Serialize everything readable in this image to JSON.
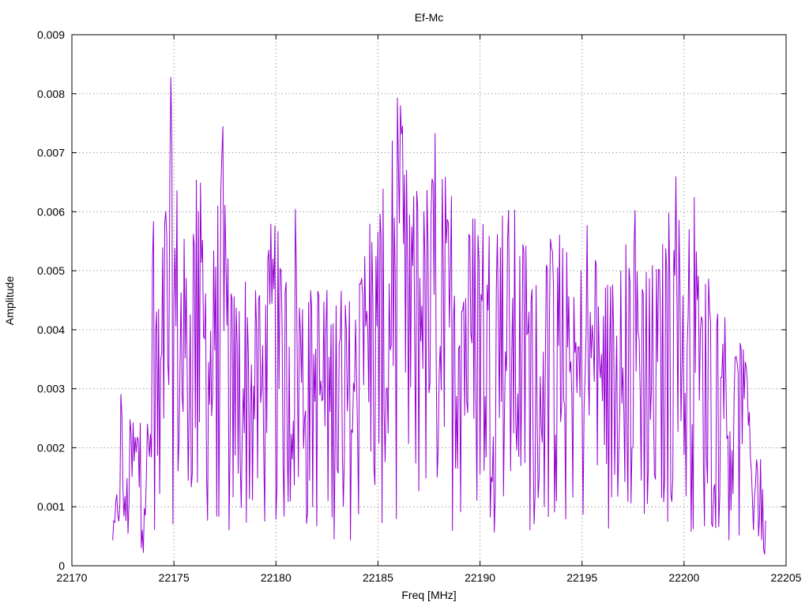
{
  "chart_data": {
    "type": "line",
    "title": "Ef-Mc",
    "xlabel": "Freq [MHz]",
    "ylabel": "Amplitude",
    "xlim": [
      22170,
      22205
    ],
    "ylim": [
      0,
      0.009
    ],
    "x_ticks": [
      "22170",
      "22175",
      "22180",
      "22185",
      "22190",
      "22195",
      "22200",
      "22205"
    ],
    "y_ticks": [
      "0",
      "0.001",
      "0.002",
      "0.003",
      "0.004",
      "0.005",
      "0.006",
      "0.007",
      "0.008",
      "0.009"
    ],
    "grid": true,
    "series_color": "#9400d3",
    "series": [
      {
        "x_start": 22172.0,
        "x_end": 22204.0,
        "x_step": 0.05,
        "peaks": [
          [
            22172.0,
            0.0006
          ],
          [
            22172.2,
            0.0014
          ],
          [
            22172.4,
            0.0035
          ],
          [
            22172.6,
            0.0012
          ],
          [
            22172.9,
            0.0028
          ],
          [
            22173.2,
            0.0029
          ],
          [
            22173.5,
            0.0024
          ],
          [
            22173.8,
            0.0029
          ],
          [
            22174.0,
            0.0062
          ],
          [
            22174.3,
            0.004
          ],
          [
            22174.5,
            0.007
          ],
          [
            22174.7,
            0.0065
          ],
          [
            22174.85,
            0.0083
          ],
          [
            22175.0,
            0.0074
          ],
          [
            22175.2,
            0.0066
          ],
          [
            22175.5,
            0.0058
          ],
          [
            22175.7,
            0.0058
          ],
          [
            22176.0,
            0.0071
          ],
          [
            22176.2,
            0.0068
          ],
          [
            22176.6,
            0.0061
          ],
          [
            22177.0,
            0.0053
          ],
          [
            22177.4,
            0.0075
          ],
          [
            22177.7,
            0.005
          ],
          [
            22178.0,
            0.0049
          ],
          [
            22178.5,
            0.0052
          ],
          [
            22179.0,
            0.0047
          ],
          [
            22179.5,
            0.005
          ],
          [
            22179.9,
            0.0064
          ],
          [
            22180.3,
            0.005
          ],
          [
            22180.6,
            0.0056
          ],
          [
            22181.0,
            0.0066
          ],
          [
            22181.2,
            0.0055
          ],
          [
            22181.6,
            0.0047
          ],
          [
            22182.0,
            0.0052
          ],
          [
            22182.6,
            0.0046
          ],
          [
            22183.0,
            0.0049
          ],
          [
            22183.6,
            0.0047
          ],
          [
            22184.0,
            0.0048
          ],
          [
            22184.6,
            0.0066
          ],
          [
            22185.0,
            0.0062
          ],
          [
            22185.5,
            0.0066
          ],
          [
            22185.85,
            0.0082
          ],
          [
            22186.2,
            0.0077
          ],
          [
            22186.6,
            0.0061
          ],
          [
            22187.0,
            0.0075
          ],
          [
            22187.5,
            0.0065
          ],
          [
            22188.0,
            0.0081
          ],
          [
            22188.4,
            0.0063
          ],
          [
            22188.8,
            0.0074
          ],
          [
            22189.1,
            0.0075
          ],
          [
            22189.5,
            0.006
          ],
          [
            22190.0,
            0.007
          ],
          [
            22190.4,
            0.006
          ],
          [
            22190.8,
            0.0072
          ],
          [
            22191.3,
            0.0063
          ],
          [
            22191.8,
            0.0061
          ],
          [
            22192.3,
            0.0055
          ],
          [
            22192.8,
            0.005
          ],
          [
            22193.3,
            0.0057
          ],
          [
            22193.8,
            0.0058
          ],
          [
            22194.3,
            0.0053
          ],
          [
            22194.8,
            0.0051
          ],
          [
            22195.3,
            0.006
          ],
          [
            22195.8,
            0.0053
          ],
          [
            22196.3,
            0.005
          ],
          [
            22196.8,
            0.0054
          ],
          [
            22197.3,
            0.0057
          ],
          [
            22197.8,
            0.0064
          ],
          [
            22198.3,
            0.0052
          ],
          [
            22198.8,
            0.0054
          ],
          [
            22199.3,
            0.0061
          ],
          [
            22199.6,
            0.0068
          ],
          [
            22200.0,
            0.005
          ],
          [
            22200.4,
            0.0068
          ],
          [
            22200.8,
            0.0052
          ],
          [
            22201.3,
            0.005
          ],
          [
            22201.8,
            0.0045
          ],
          [
            22202.3,
            0.004
          ],
          [
            22202.8,
            0.004
          ],
          [
            22203.2,
            0.003
          ],
          [
            22203.6,
            0.0025
          ],
          [
            22204.0,
            0.0008
          ]
        ]
      }
    ]
  }
}
